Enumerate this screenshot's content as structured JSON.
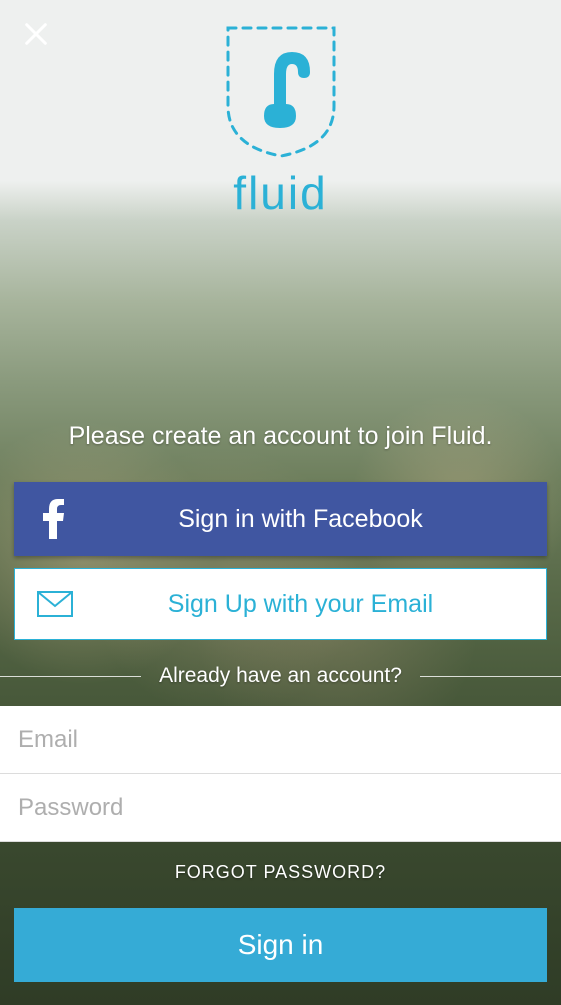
{
  "brand": {
    "name": "fluid"
  },
  "close": {
    "aria": "Close"
  },
  "prompt": "Please create an account to join Fluid.",
  "buttons": {
    "facebook_label": "Sign in with Facebook",
    "email_label": "Sign Up with your Email",
    "signin_label": "Sign in"
  },
  "divider": {
    "text": "Already have an account?"
  },
  "inputs": {
    "email_placeholder": "Email",
    "password_placeholder": "Password",
    "email_value": "",
    "password_value": ""
  },
  "forgot_label": "FORGOT PASSWORD?",
  "colors": {
    "accent": "#2bb1d6",
    "facebook": "#4056a1",
    "signin": "#35abd6"
  }
}
